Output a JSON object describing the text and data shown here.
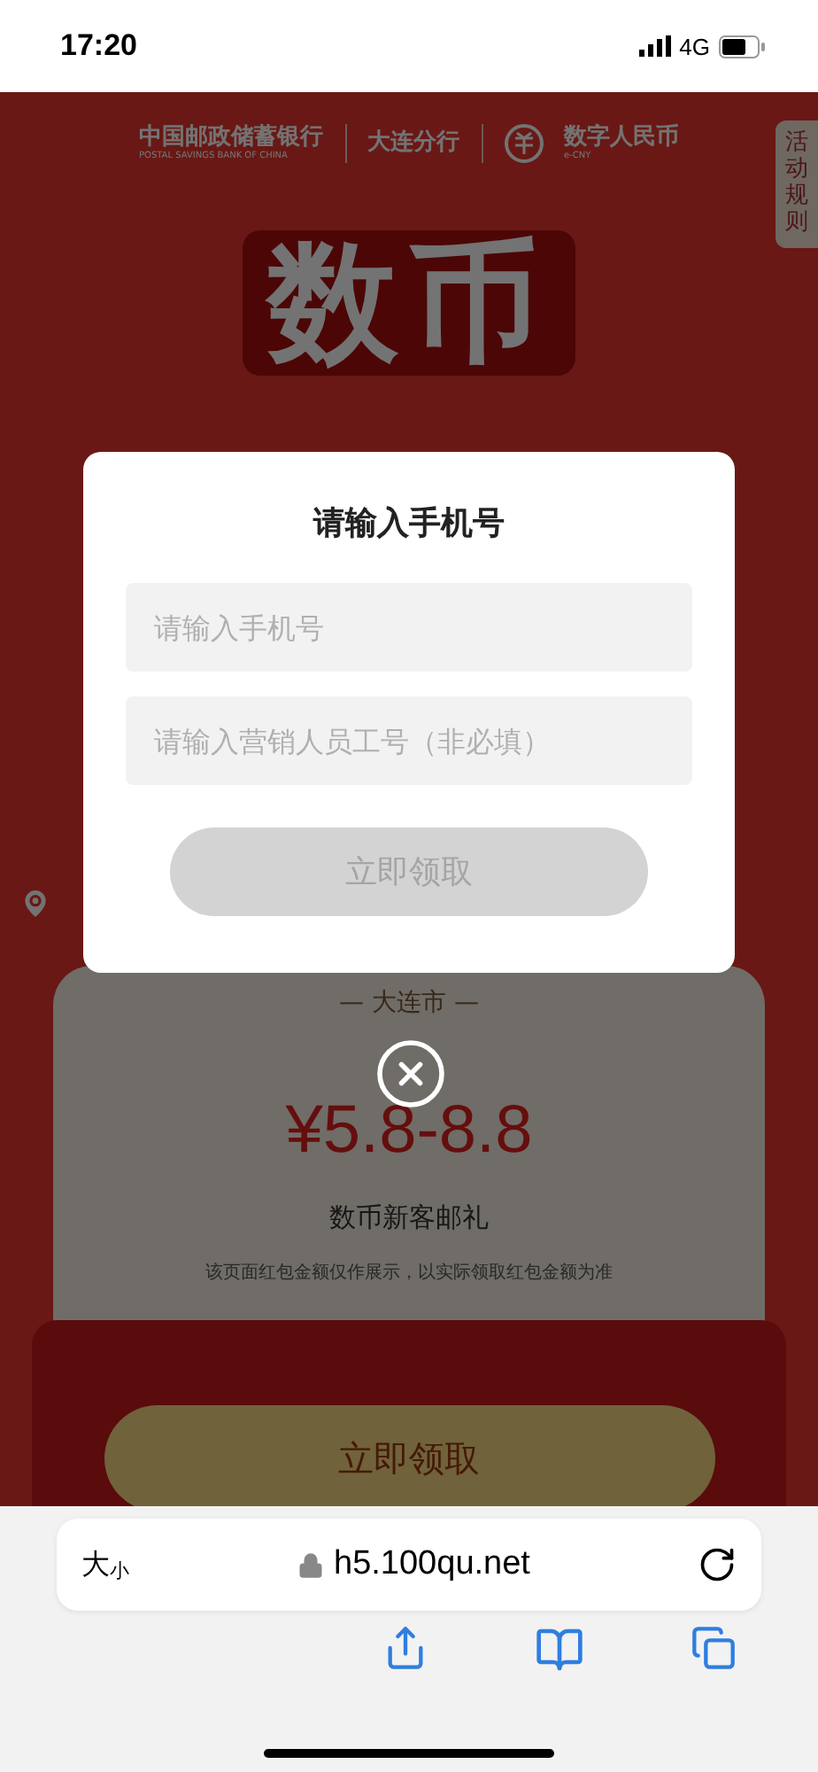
{
  "status_bar": {
    "time": "17:20",
    "network": "4G"
  },
  "page": {
    "bank": {
      "name": "中国邮政储蓄银行",
      "english": "POSTAL SAVINGS BANK OF CHINA"
    },
    "branch": "大连分行",
    "ecny": {
      "name": "数字人民币",
      "english": "e-CNY"
    },
    "rules_tab": "活动规则",
    "hero": "数币",
    "card": {
      "city": "— 大连市 —",
      "amount": "¥5.8-8.8",
      "title": "数币新客邮礼",
      "note": "该页面红包金额仅作展示，以实际领取红包金额为准",
      "button": "立即领取"
    }
  },
  "modal": {
    "title": "请输入手机号",
    "fields": [
      {
        "placeholder": "请输入手机号"
      },
      {
        "placeholder": "请输入营销人员工号（非必填）"
      }
    ],
    "button": {
      "label": "立即领取",
      "disabled": true
    }
  },
  "browser": {
    "text_size": [
      "大",
      "小"
    ],
    "url": "h5.100qu.net"
  }
}
